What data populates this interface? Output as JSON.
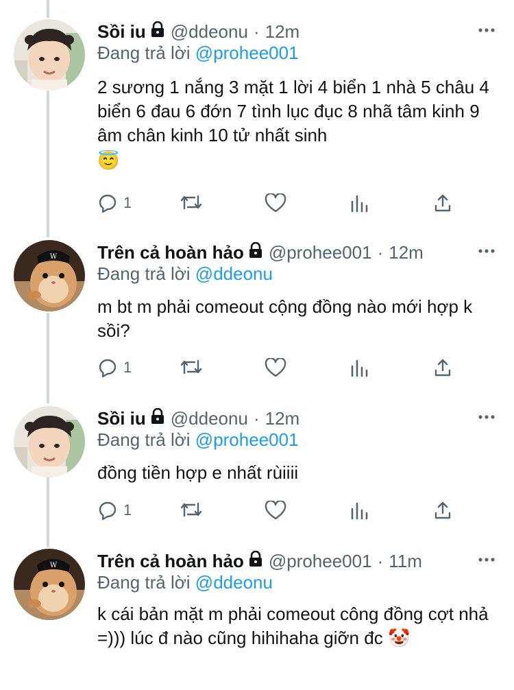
{
  "tweets": [
    {
      "name": "Sồi iu",
      "handle": "@ddeonu",
      "time": "12m",
      "replying_label": "Đang trả lời",
      "replying_to": "@prohee001",
      "body_text": "2 sương 1 nắng 3 mặt 1 lời 4 biển 1 nhà 5 châu 4 biển 6 đau 6 đớn 7 tình lục đục 8 nhã tâm kinh 9 âm chân kinh 10 tử nhất sinh",
      "emoji": "😇",
      "reply_count": "1",
      "avatar": "child-with-pigtails"
    },
    {
      "name": "Trên cả hoàn hảo",
      "handle": "@prohee001",
      "time": "12m",
      "replying_label": "Đang trả lời",
      "replying_to": "@ddeonu",
      "body_text": "m bt m phải comeout cộng đồng nào mới hợp k sồi?",
      "emoji": "",
      "reply_count": "1",
      "avatar": "hamster-with-cap"
    },
    {
      "name": "Sồi iu",
      "handle": "@ddeonu",
      "time": "12m",
      "replying_label": "Đang trả lời",
      "replying_to": "@prohee001",
      "body_text": "đồng tiền hợp e nhất rùiiii",
      "emoji": "",
      "reply_count": "1",
      "avatar": "child-with-pigtails"
    },
    {
      "name": "Trên cả hoàn hảo",
      "handle": "@prohee001",
      "time": "11m",
      "replying_label": "Đang trả lời",
      "replying_to": "@ddeonu",
      "body_text": "k cái bản mặt m phải comeout công đồng cợt nhả =))) lúc đ nào cũng hihihaha giỡn đc",
      "emoji": "🤡",
      "avatar": "hamster-with-cap"
    }
  ],
  "colors": {
    "link": "#1d9bf0",
    "secondary": "#536471",
    "thread_line": "#cfd9de"
  }
}
